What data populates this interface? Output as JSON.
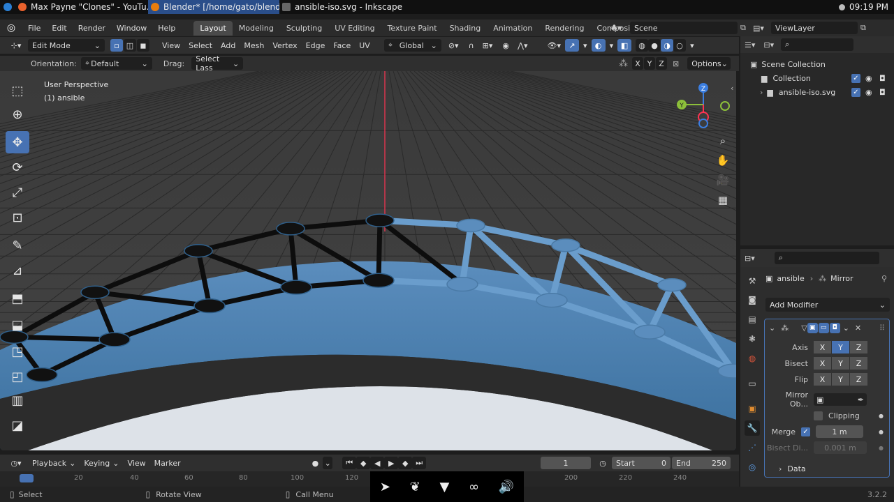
{
  "taskbar": {
    "tasks": [
      {
        "label": "Max Payne \"Clones\" - YouTu...",
        "icon": "firefox-icon"
      },
      {
        "label": "Blender* [/home/gato/blend...",
        "icon": "blender-icon"
      },
      {
        "label": "ansible-iso.svg - Inkscape",
        "icon": "inkscape-icon"
      }
    ],
    "clock": "09:19 PM"
  },
  "menu": [
    "File",
    "Edit",
    "Render",
    "Window",
    "Help"
  ],
  "workspaces": [
    "Layout",
    "Modeling",
    "Sculpting",
    "UV Editing",
    "Texture Paint",
    "Shading",
    "Animation",
    "Rendering",
    "Compositing"
  ],
  "scene": "Scene",
  "view_layer": "ViewLayer",
  "header": {
    "mode": "Edit Mode",
    "menus": [
      "View",
      "Select",
      "Add",
      "Mesh",
      "Vertex",
      "Edge",
      "Face",
      "UV"
    ],
    "transform": "Global",
    "orientation_label": "Orientation:",
    "orientation": "Default",
    "drag_label": "Drag:",
    "drag": "Select Lass",
    "axes": [
      "X",
      "Y",
      "Z"
    ],
    "options": "Options"
  },
  "viewport": {
    "title": "User Perspective",
    "object": "(1) ansible",
    "gizmo": {
      "z": "Z",
      "y": "Y"
    }
  },
  "outliner": {
    "root": "Scene Collection",
    "items": [
      {
        "label": "Collection"
      },
      {
        "label": "ansible-iso.svg"
      }
    ]
  },
  "properties": {
    "breadcrumb": [
      "ansible",
      "Mirror"
    ],
    "add_modifier": "Add Modifier",
    "axis_label": "Axis",
    "bisect_label": "Bisect",
    "flip_label": "Flip",
    "axes": [
      "X",
      "Y",
      "Z"
    ],
    "mirror_obj_label": "Mirror Ob...",
    "clipping_label": "Clipping",
    "merge_label": "Merge",
    "merge_value": "1 m",
    "bisect_dist_label": "Bisect Di...",
    "bisect_dist_value": "0.001 m",
    "data_label": "Data"
  },
  "timeline": {
    "playback": "Playback",
    "keying": "Keying",
    "view": "View",
    "marker": "Marker",
    "current_frame": "1",
    "start_label": "Start",
    "start": "0",
    "end_label": "End",
    "end": "250",
    "ticks": [
      "0",
      "20",
      "40",
      "60",
      "80",
      "100",
      "120",
      "200",
      "220",
      "240"
    ]
  },
  "status": {
    "select": "Select",
    "rotate": "Rotate View",
    "call_menu": "Call Menu",
    "version": "3.2.2"
  },
  "colors": {
    "accent": "#4772b3",
    "mesh_blue": "#5b8dbd",
    "axis_red": "#ff3352"
  }
}
